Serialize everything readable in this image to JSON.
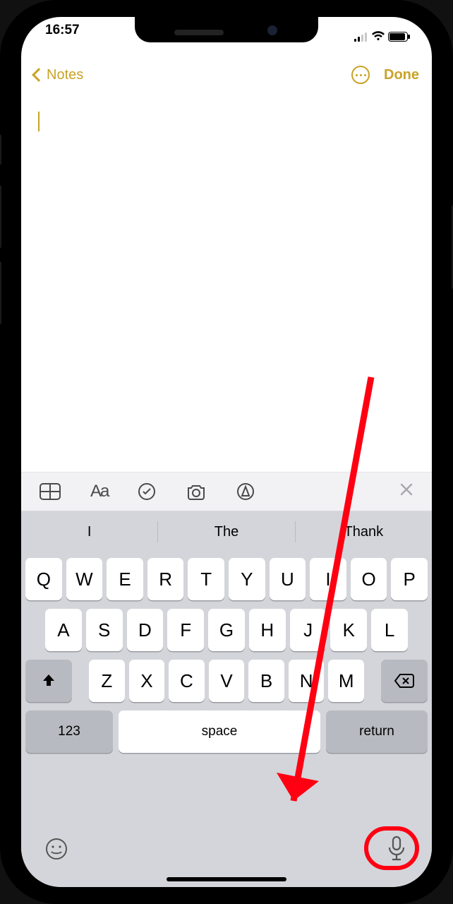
{
  "status": {
    "time": "16:57"
  },
  "nav": {
    "back_label": "Notes",
    "done_label": "Done"
  },
  "toolbar": {
    "close_label": "✕"
  },
  "predictions": [
    "I",
    "The",
    "Thank"
  ],
  "keyboard": {
    "row1": [
      "Q",
      "W",
      "E",
      "R",
      "T",
      "Y",
      "U",
      "I",
      "O",
      "P"
    ],
    "row2": [
      "A",
      "S",
      "D",
      "F",
      "G",
      "H",
      "J",
      "K",
      "L"
    ],
    "row3": [
      "Z",
      "X",
      "C",
      "V",
      "B",
      "N",
      "M"
    ],
    "numbers_label": "123",
    "space_label": "space",
    "return_label": "return"
  },
  "annotation": {
    "target": "dictation-mic-button"
  }
}
